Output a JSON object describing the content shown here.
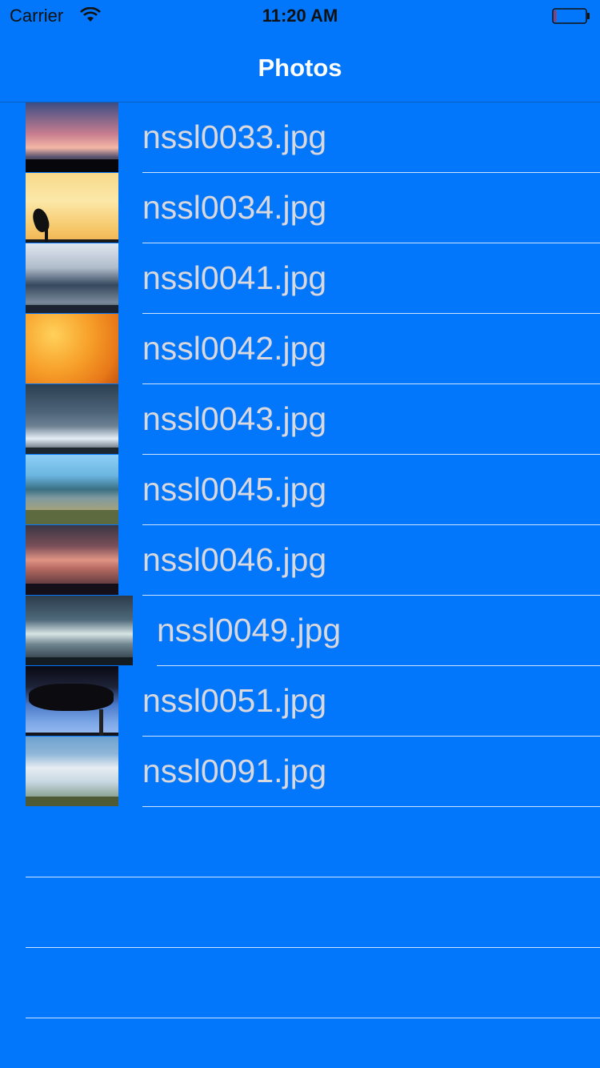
{
  "status_bar": {
    "carrier": "Carrier",
    "time": "11:20 AM",
    "wifi_icon": "wifi-icon",
    "battery_icon": "battery-icon"
  },
  "nav": {
    "title": "Photos"
  },
  "rows": [
    {
      "label": "nssl0033.jpg",
      "thumb_icon": "photo-thumbnail"
    },
    {
      "label": "nssl0034.jpg",
      "thumb_icon": "photo-thumbnail"
    },
    {
      "label": "nssl0041.jpg",
      "thumb_icon": "photo-thumbnail"
    },
    {
      "label": "nssl0042.jpg",
      "thumb_icon": "photo-thumbnail"
    },
    {
      "label": "nssl0043.jpg",
      "thumb_icon": "photo-thumbnail"
    },
    {
      "label": "nssl0045.jpg",
      "thumb_icon": "photo-thumbnail"
    },
    {
      "label": "nssl0046.jpg",
      "thumb_icon": "photo-thumbnail"
    },
    {
      "label": "nssl0049.jpg",
      "thumb_icon": "photo-thumbnail"
    },
    {
      "label": "nssl0051.jpg",
      "thumb_icon": "photo-thumbnail"
    },
    {
      "label": "nssl0091.jpg",
      "thumb_icon": "photo-thumbnail"
    }
  ],
  "colors": {
    "background": "#0277fb",
    "label_text": "#d8d8de",
    "separator": "#cfe3fb",
    "nav_title": "#ffffff"
  }
}
